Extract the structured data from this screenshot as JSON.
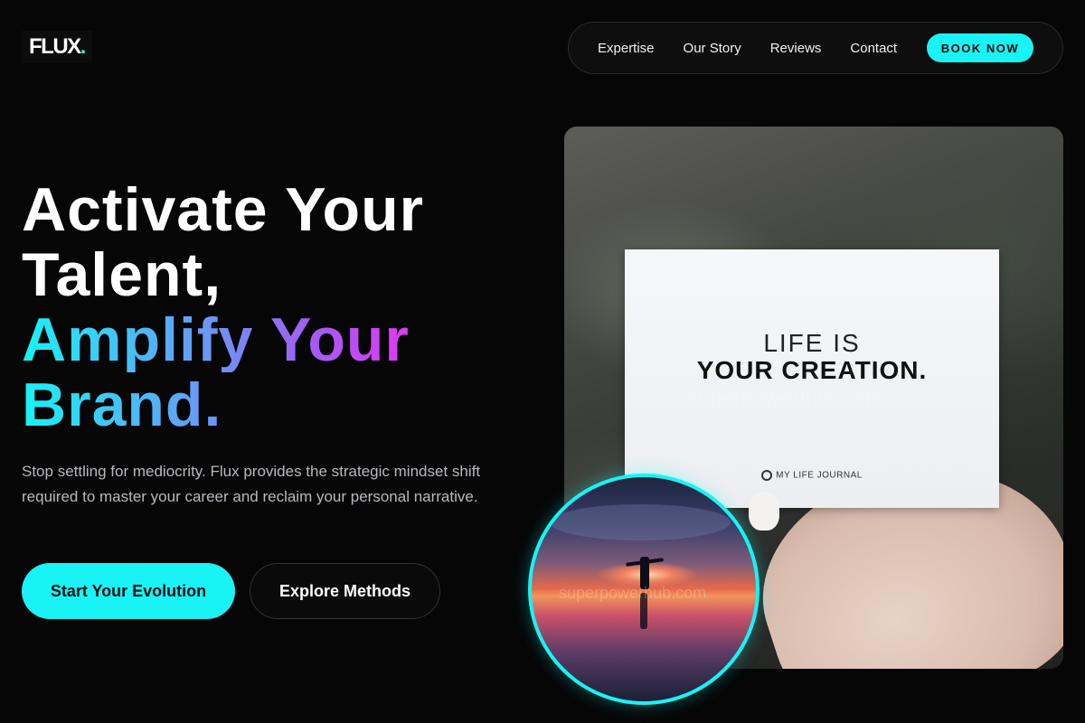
{
  "brand": {
    "name": "FLUX",
    "dot": ".",
    "accent": "#18f3f5"
  },
  "nav": {
    "links": [
      "Expertise",
      "Our Story",
      "Reviews",
      "Contact"
    ],
    "cta": "BOOK NOW"
  },
  "hero": {
    "line1": "Activate Your",
    "line2": "Talent,",
    "line3": "Amplify Your",
    "line4": "Brand.",
    "gradient": [
      "#18f3f5",
      "#6a97f7",
      "#a35cf3",
      "#f030f0"
    ],
    "description": "Stop settling for mediocrity. Flux provides the strategic mindset shift required to master your career and reclaim your personal narrative.",
    "primary_cta": "Start Your Evolution",
    "secondary_cta": "Explore Methods"
  },
  "image_card": {
    "line1": "LIFE IS",
    "line2": "YOUR CREATION.",
    "footer": "MY LIFE JOURNAL",
    "watermark": "superpowerhub.com"
  },
  "circle_image": {
    "watermark": "superpowerhub.com"
  }
}
